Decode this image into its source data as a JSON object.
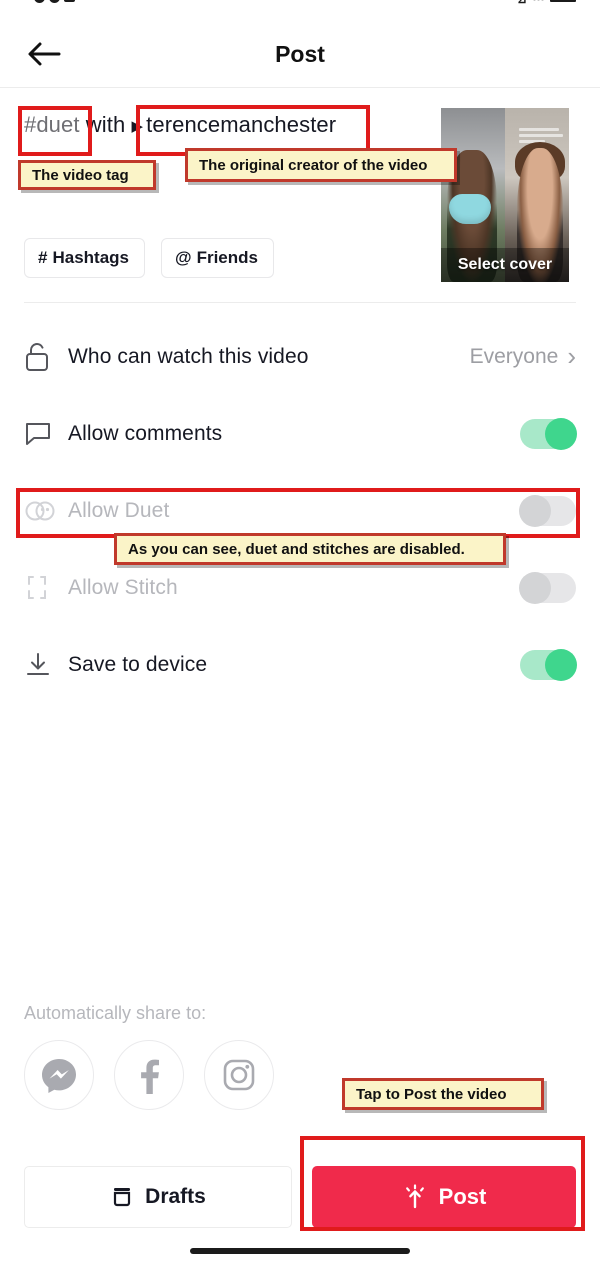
{
  "statusbar": {
    "time": ""
  },
  "header": {
    "title": "Post",
    "back_icon": "arrow-left-icon"
  },
  "caption": {
    "tag": "#duet",
    "with": " with ",
    "play_glyph": "▶",
    "mention": "terencemanchester"
  },
  "chips": [
    {
      "icon": "hash-icon",
      "glyph": "#",
      "label": "Hashtags"
    },
    {
      "icon": "at-icon",
      "glyph": "@",
      "label": "Friends"
    }
  ],
  "cover": {
    "select_cover_label": "Select cover"
  },
  "settings": [
    {
      "icon": "unlock-icon",
      "label": "Who can watch this video",
      "value": "Everyone",
      "chevron": "›",
      "control": "value",
      "disabled": false
    },
    {
      "icon": "comment-bubble-icon",
      "label": "Allow comments",
      "control": "toggle",
      "toggle_state": "on",
      "disabled": false
    },
    {
      "icon": "duet-icon",
      "label": "Allow Duet",
      "control": "toggle",
      "toggle_state": "off",
      "disabled": true
    },
    {
      "icon": "stitch-icon",
      "label": "Allow Stitch",
      "control": "toggle",
      "toggle_state": "off",
      "disabled": true
    },
    {
      "icon": "download-icon",
      "label": "Save to device",
      "control": "toggle",
      "toggle_state": "on",
      "disabled": false
    }
  ],
  "share": {
    "label": "Automatically share to:",
    "targets": [
      {
        "icon": "messenger-icon",
        "name": "Messenger"
      },
      {
        "icon": "facebook-icon",
        "name": "Facebook"
      },
      {
        "icon": "instagram-icon",
        "name": "Instagram"
      }
    ]
  },
  "bottom": {
    "drafts_label": "Drafts",
    "drafts_icon": "drafts-box-icon",
    "post_label": "Post",
    "post_icon": "upload-burst-icon",
    "post_color": "#f02a4b"
  },
  "annotations": {
    "highlight_color": "#e01b1b",
    "callout_bg": "#fbf4c8",
    "items": [
      {
        "text": "The video tag"
      },
      {
        "text": "The original creator of the video"
      },
      {
        "text": "As you can see, duet and stitches are disabled."
      },
      {
        "text": "Tap to Post the video"
      }
    ]
  }
}
